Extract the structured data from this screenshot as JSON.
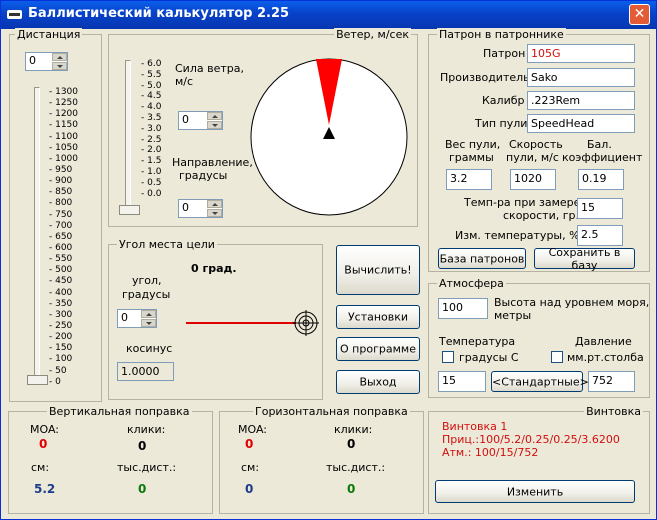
{
  "title": "Баллистический калькулятор 2.25",
  "distance": {
    "label": "Дистанция",
    "value": "0",
    "ticks": [
      "1300",
      "1250",
      "1200",
      "1150",
      "1100",
      "1050",
      "1000",
      "950",
      "900",
      "850",
      "800",
      "750",
      "700",
      "650",
      "600",
      "550",
      "500",
      "450",
      "400",
      "350",
      "300",
      "250",
      "200",
      "150",
      "100",
      "50",
      "0"
    ]
  },
  "wind": {
    "label": "Ветер, м/сек",
    "strength_label_1": "Сила ветра,",
    "strength_label_2": "м/с",
    "strength_value": "0",
    "direction_label_1": "Направление,",
    "direction_label_2": "градусы",
    "direction_value": "0",
    "ticks": [
      "6.0",
      "5.5",
      "5.0",
      "4.5",
      "4.0",
      "3.5",
      "3.0",
      "2.5",
      "2.0",
      "1.5",
      "1.0",
      "0.5",
      "0.0"
    ]
  },
  "angle": {
    "label": "Угол места цели",
    "display": "0 град.",
    "angle_label_1": "угол,",
    "angle_label_2": "градусы",
    "angle_value": "0",
    "cos_label": "косинус",
    "cos_value": "1.0000"
  },
  "buttons": {
    "calculate": "Вычислить!",
    "settings": "Установки",
    "about": "О программе",
    "exit": "Выход"
  },
  "cartridge": {
    "label": "Патрон в патроннике",
    "cartridge_label": "Патрон",
    "cartridge_value": "105G",
    "maker_label": "Производитель",
    "maker_value": "Sako",
    "caliber_label": "Калибр",
    "caliber_value": ".223Rem",
    "bullet_label": "Тип пули",
    "bullet_value": "SpeedHead",
    "weight_label_1": "Вес пули,",
    "weight_label_2": "граммы",
    "weight_value": "3.2",
    "speed_label_1": "Скорость",
    "speed_label_2": "пули, м/с",
    "speed_value": "1020",
    "bc_label_1": "Бал.",
    "bc_label_2": "коэффициент",
    "bc_value": "0.19",
    "temp_label_1": "Темп-ра при замере",
    "temp_label_2": "скорости, гр.",
    "temp_value": "15",
    "tempchange_label": "Изм. температуры, %",
    "tempchange_value": "2.5",
    "db_button": "База патронов",
    "save_button": "Сохранить в базу"
  },
  "atmosphere": {
    "label": "Атмосфера",
    "altitude_value": "100",
    "altitude_label_1": "Высота над уровнем моря,",
    "altitude_label_2": "метры",
    "temperature_label": "Температура",
    "pressure_label": "Давление",
    "celsius_label": "градусы С",
    "mmhg_label": "мм.рт.столба",
    "temperature_value": "15",
    "standard_button": "<Стандартные>",
    "pressure_value": "752"
  },
  "vertical": {
    "label": "Вертикальная поправка",
    "moa_label": "MOA:",
    "moa_value": "0",
    "clicks_label": "клики:",
    "clicks_value": "0",
    "cm_label": "см:",
    "cm_value": "5.2",
    "ths_label": "тыс.дист.:",
    "ths_value": "0"
  },
  "horizontal": {
    "label": "Горизонтальная поправка",
    "moa_label": "MOA:",
    "moa_value": "0",
    "clicks_label": "клики:",
    "clicks_value": "0",
    "cm_label": "см:",
    "cm_value": "0",
    "ths_label": "тыс.дист.:",
    "ths_value": "0"
  },
  "rifle": {
    "label": "Винтовка",
    "line1": "Винтовка 1",
    "line2": "Приц.:100/5.2/0.25/0.25/3.6200",
    "line3": "Атм.: 100/15/752",
    "change_button": "Изменить"
  },
  "colors": {
    "title_bar": "#0842C8",
    "wind_arrow": "#FF0000",
    "vertical_moa": "#E00000",
    "cm_value": "#1C3C8C",
    "ths_value": "#0A7A0A"
  },
  "icons": [
    "app-icon",
    "close-icon",
    "spin-up-icon",
    "spin-down-icon",
    "wind-compass-icon",
    "wind-direction-arrow-icon",
    "scope-reticle-icon"
  ]
}
